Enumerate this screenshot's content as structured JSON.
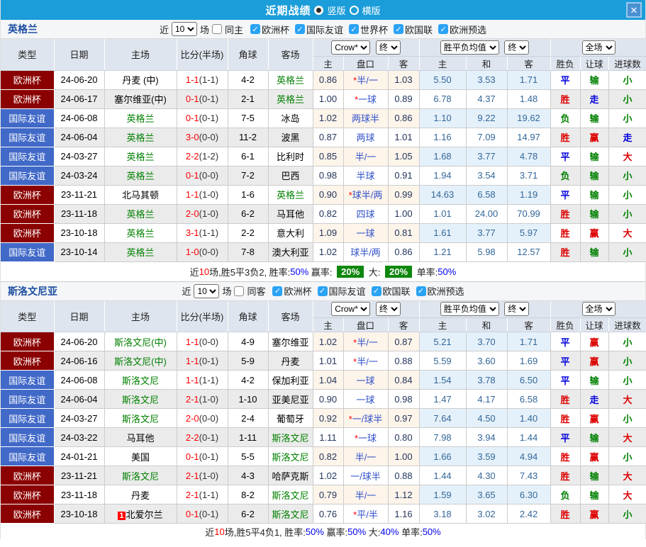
{
  "titlebar": {
    "title": "近期战绩",
    "vertical": "竖版",
    "horizontal": "横版",
    "close": "✕"
  },
  "labels": {
    "near": "近",
    "games": "场"
  },
  "dropdowns": {
    "bookmaker": "Crow*",
    "final": "终",
    "avg": "胜平负均值",
    "final2": "终",
    "scope": "全场"
  },
  "cols": {
    "type": "类型",
    "date": "日期",
    "home": "主场",
    "score": "比分(半场)",
    "corner": "角球",
    "away": "客场",
    "h_home": "主",
    "handicap": "盘口",
    "h_away": "客",
    "e_home": "主",
    "e_draw": "和",
    "e_away": "客",
    "r_wdl": "胜负",
    "r_handicap": "让球",
    "r_goals": "进球数"
  },
  "colors": {
    "topbar": "#1b9dd9",
    "header_bg": "#dfe5ee",
    "team_green": "#008000",
    "score_red": "#ff0000",
    "summary_badge_green": "#0e870e"
  },
  "type_colors": {
    "欧洲杯": "#8b0000",
    "国际友谊": "#4169c8"
  },
  "result_colors": {
    "胜": "#dd0000",
    "平": "#0000dd",
    "负": "#008000",
    "赢": "#dd0000",
    "走": "#0000dd",
    "输": "#008000",
    "大": "#dd0000",
    "小": "#008000"
  },
  "sections": [
    {
      "team": "英格兰",
      "filter": {
        "count": "10",
        "same_label": "同主",
        "competitions": [
          "欧洲杯",
          "国际友谊",
          "世界杯",
          "欧国联",
          "欧洲预选"
        ]
      },
      "rows": [
        {
          "type": "欧洲杯",
          "date": "24-06-20",
          "home": "丹麦 (中)",
          "home_green": false,
          "score": "1-1",
          "half": "(1-1)",
          "corner": "4-2",
          "away": "英格兰",
          "away_green": true,
          "h1": "0.86",
          "star": true,
          "line": "半/一",
          "h2": "1.03",
          "o1": "5.50",
          "o2": "3.53",
          "o3": "1.71",
          "r1": "平",
          "r2": "输",
          "r3": "小"
        },
        {
          "type": "欧洲杯",
          "date": "24-06-17",
          "home": "塞尔维亚(中)",
          "home_green": false,
          "score": "0-1",
          "half": "(0-1)",
          "corner": "2-1",
          "away": "英格兰",
          "away_green": true,
          "h1": "1.00",
          "star": true,
          "line": "一球",
          "h2": "0.89",
          "o1": "6.78",
          "o2": "4.37",
          "o3": "1.48",
          "r1": "胜",
          "r2": "走",
          "r3": "小"
        },
        {
          "type": "国际友谊",
          "date": "24-06-08",
          "home": "英格兰",
          "home_green": true,
          "score": "0-1",
          "half": "(0-1)",
          "corner": "7-5",
          "away": "冰岛",
          "away_green": false,
          "h1": "1.02",
          "star": false,
          "line": "两球半",
          "h2": "0.86",
          "o1": "1.10",
          "o2": "9.22",
          "o3": "19.62",
          "r1": "负",
          "r2": "输",
          "r3": "小"
        },
        {
          "type": "国际友谊",
          "date": "24-06-04",
          "home": "英格兰",
          "home_green": true,
          "score": "3-0",
          "half": "(0-0)",
          "corner": "11-2",
          "away": "波黑",
          "away_green": false,
          "h1": "0.87",
          "star": false,
          "line": "两球",
          "h2": "1.01",
          "o1": "1.16",
          "o2": "7.09",
          "o3": "14.97",
          "r1": "胜",
          "r2": "赢",
          "r3": "走"
        },
        {
          "type": "国际友谊",
          "date": "24-03-27",
          "home": "英格兰",
          "home_green": true,
          "score": "2-2",
          "half": "(1-2)",
          "corner": "6-1",
          "away": "比利时",
          "away_green": false,
          "h1": "0.85",
          "star": false,
          "line": "半/一",
          "h2": "1.05",
          "o1": "1.68",
          "o2": "3.77",
          "o3": "4.78",
          "r1": "平",
          "r2": "输",
          "r3": "大"
        },
        {
          "type": "国际友谊",
          "date": "24-03-24",
          "home": "英格兰",
          "home_green": true,
          "score": "0-1",
          "half": "(0-0)",
          "corner": "7-2",
          "away": "巴西",
          "away_green": false,
          "h1": "0.98",
          "star": false,
          "line": "半球",
          "h2": "0.91",
          "o1": "1.94",
          "o2": "3.54",
          "o3": "3.71",
          "r1": "负",
          "r2": "输",
          "r3": "小"
        },
        {
          "type": "欧洲杯",
          "date": "23-11-21",
          "home": "北马其顿",
          "home_green": false,
          "score": "1-1",
          "half": "(1-0)",
          "corner": "1-6",
          "away": "英格兰",
          "away_green": true,
          "h1": "0.90",
          "star": true,
          "line": "球半/两",
          "h2": "0.99",
          "o1": "14.63",
          "o2": "6.58",
          "o3": "1.19",
          "r1": "平",
          "r2": "输",
          "r3": "小"
        },
        {
          "type": "欧洲杯",
          "date": "23-11-18",
          "home": "英格兰",
          "home_green": true,
          "score": "2-0",
          "half": "(1-0)",
          "corner": "6-2",
          "away": "马耳他",
          "away_green": false,
          "h1": "0.82",
          "star": false,
          "line": "四球",
          "h2": "1.00",
          "o1": "1.01",
          "o2": "24.00",
          "o3": "70.99",
          "r1": "胜",
          "r2": "输",
          "r3": "小"
        },
        {
          "type": "欧洲杯",
          "date": "23-10-18",
          "home": "英格兰",
          "home_green": true,
          "score": "3-1",
          "half": "(1-1)",
          "corner": "2-2",
          "away": "意大利",
          "away_green": false,
          "h1": "1.09",
          "star": false,
          "line": "一球",
          "h2": "0.81",
          "o1": "1.61",
          "o2": "3.77",
          "o3": "5.97",
          "r1": "胜",
          "r2": "赢",
          "r3": "大"
        },
        {
          "type": "国际友谊",
          "date": "23-10-14",
          "home": "英格兰",
          "home_green": true,
          "score": "1-0",
          "half": "(0-0)",
          "corner": "7-8",
          "away": "澳大利亚",
          "away_green": false,
          "h1": "1.02",
          "star": false,
          "line": "球半/两",
          "h2": "0.86",
          "o1": "1.21",
          "o2": "5.98",
          "o3": "12.57",
          "r1": "胜",
          "r2": "输",
          "r3": "小"
        }
      ],
      "summary": [
        {
          "text": "近",
          "style": ""
        },
        {
          "text": "10",
          "style": "red"
        },
        {
          "text": "场,胜5平3负2, 胜率:",
          "style": ""
        },
        {
          "text": "50%",
          "style": "blue"
        },
        {
          "text": " 赢率: ",
          "style": ""
        },
        {
          "text": "20%",
          "style": "badge"
        },
        {
          "text": " 大: ",
          "style": ""
        },
        {
          "text": "20%",
          "style": "badge"
        },
        {
          "text": " 单率:",
          "style": ""
        },
        {
          "text": "50%",
          "style": "blue"
        }
      ]
    },
    {
      "team": "斯洛文尼亚",
      "filter": {
        "count": "10",
        "same_label": "同客",
        "competitions": [
          "欧洲杯",
          "国际友谊",
          "欧国联",
          "欧洲预选"
        ]
      },
      "rows": [
        {
          "type": "欧洲杯",
          "date": "24-06-20",
          "home": "斯洛文尼(中)",
          "home_green": true,
          "score": "1-1",
          "half": "(0-0)",
          "corner": "4-9",
          "away": "塞尔维亚",
          "away_green": false,
          "h1": "1.02",
          "star": true,
          "line": "半/一",
          "h2": "0.87",
          "o1": "5.21",
          "o2": "3.70",
          "o3": "1.71",
          "r1": "平",
          "r2": "赢",
          "r3": "小"
        },
        {
          "type": "欧洲杯",
          "date": "24-06-16",
          "home": "斯洛文尼(中)",
          "home_green": true,
          "score": "1-1",
          "half": "(0-1)",
          "corner": "5-9",
          "away": "丹麦",
          "away_green": false,
          "h1": "1.01",
          "star": true,
          "line": "半/一",
          "h2": "0.88",
          "o1": "5.59",
          "o2": "3.60",
          "o3": "1.69",
          "r1": "平",
          "r2": "赢",
          "r3": "小"
        },
        {
          "type": "国际友谊",
          "date": "24-06-08",
          "home": "斯洛文尼",
          "home_green": true,
          "score": "1-1",
          "half": "(1-1)",
          "corner": "4-2",
          "away": "保加利亚",
          "away_green": false,
          "h1": "1.04",
          "star": false,
          "line": "一球",
          "h2": "0.84",
          "o1": "1.54",
          "o2": "3.78",
          "o3": "6.50",
          "r1": "平",
          "r2": "输",
          "r3": "小"
        },
        {
          "type": "国际友谊",
          "date": "24-06-04",
          "home": "斯洛文尼",
          "home_green": true,
          "score": "2-1",
          "half": "(1-0)",
          "corner": "1-10",
          "away": "亚美尼亚",
          "away_green": false,
          "h1": "0.90",
          "star": false,
          "line": "一球",
          "h2": "0.98",
          "o1": "1.47",
          "o2": "4.17",
          "o3": "6.58",
          "r1": "胜",
          "r2": "走",
          "r3": "大"
        },
        {
          "type": "国际友谊",
          "date": "24-03-27",
          "home": "斯洛文尼",
          "home_green": true,
          "score": "2-0",
          "half": "(0-0)",
          "corner": "2-4",
          "away": "葡萄牙",
          "away_green": false,
          "h1": "0.92",
          "star": true,
          "line": "一/球半",
          "h2": "0.97",
          "o1": "7.64",
          "o2": "4.50",
          "o3": "1.40",
          "r1": "胜",
          "r2": "赢",
          "r3": "小"
        },
        {
          "type": "国际友谊",
          "date": "24-03-22",
          "home": "马耳他",
          "home_green": false,
          "score": "2-2",
          "half": "(0-1)",
          "corner": "1-11",
          "away": "斯洛文尼",
          "away_green": true,
          "h1": "1.11",
          "star": true,
          "line": "一球",
          "h2": "0.80",
          "o1": "7.98",
          "o2": "3.94",
          "o3": "1.44",
          "r1": "平",
          "r2": "输",
          "r3": "大"
        },
        {
          "type": "国际友谊",
          "date": "24-01-21",
          "home": "美国",
          "home_green": false,
          "score": "0-1",
          "half": "(0-1)",
          "corner": "5-5",
          "away": "斯洛文尼",
          "away_green": true,
          "h1": "0.82",
          "star": false,
          "line": "半/一",
          "h2": "1.00",
          "o1": "1.66",
          "o2": "3.59",
          "o3": "4.94",
          "r1": "胜",
          "r2": "赢",
          "r3": "小"
        },
        {
          "type": "欧洲杯",
          "date": "23-11-21",
          "home": "斯洛文尼",
          "home_green": true,
          "score": "2-1",
          "half": "(1-0)",
          "corner": "4-3",
          "away": "哈萨克斯",
          "away_green": false,
          "h1": "1.02",
          "star": false,
          "line": "一/球半",
          "h2": "0.88",
          "o1": "1.44",
          "o2": "4.30",
          "o3": "7.43",
          "r1": "胜",
          "r2": "输",
          "r3": "大"
        },
        {
          "type": "欧洲杯",
          "date": "23-11-18",
          "home": "丹麦",
          "home_green": false,
          "score": "2-1",
          "half": "(1-1)",
          "corner": "8-2",
          "away": "斯洛文尼",
          "away_green": true,
          "h1": "0.79",
          "star": false,
          "line": "半/一",
          "h2": "1.12",
          "o1": "1.59",
          "o2": "3.65",
          "o3": "6.30",
          "r1": "负",
          "r2": "输",
          "r3": "大"
        },
        {
          "type": "欧洲杯",
          "date": "23-10-18",
          "home": "北爱尔兰",
          "home_green": false,
          "home_badge": "1",
          "score": "0-1",
          "half": "(0-1)",
          "corner": "6-2",
          "away": "斯洛文尼",
          "away_green": true,
          "h1": "0.76",
          "star": true,
          "line": "平/半",
          "h2": "1.16",
          "o1": "3.18",
          "o2": "3.02",
          "o3": "2.42",
          "r1": "胜",
          "r2": "赢",
          "r3": "小"
        }
      ],
      "summary": [
        {
          "text": "近",
          "style": ""
        },
        {
          "text": "10",
          "style": "red"
        },
        {
          "text": "场,胜5平4负1, 胜率:",
          "style": ""
        },
        {
          "text": "50%",
          "style": "blue"
        },
        {
          "text": " 赢率:",
          "style": ""
        },
        {
          "text": "50%",
          "style": "blue"
        },
        {
          "text": " 大:",
          "style": ""
        },
        {
          "text": "40%",
          "style": "blue"
        },
        {
          "text": " 单率:",
          "style": ""
        },
        {
          "text": "50%",
          "style": "blue"
        }
      ]
    }
  ]
}
